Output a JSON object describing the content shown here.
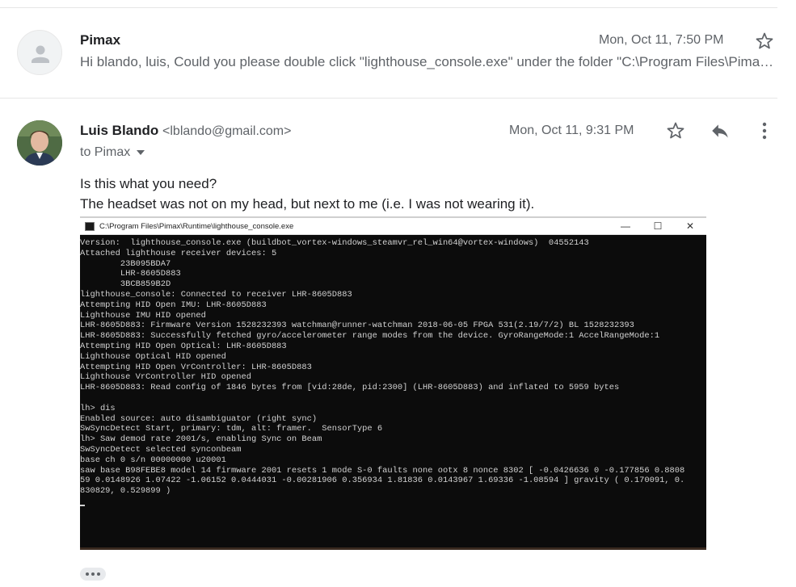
{
  "message1": {
    "sender": "Pimax",
    "date": "Mon, Oct 11, 7:50 PM",
    "snippet": "Hi blando, luis, Could you please double click \"lighthouse_console.exe\" under the folder \"C:\\Program Files\\Pimax\\Runtime\" and ..."
  },
  "message2": {
    "sender": "Luis Blando",
    "email": "<lblando@gmail.com>",
    "date": "Mon, Oct 11, 9:31 PM",
    "to": "to Pimax",
    "body": [
      "Is this what you need?",
      "The headset was not on my head, but next to me (i.e. I was not wearing it)."
    ]
  },
  "console": {
    "title": "C:\\Program Files\\Pimax\\Runtime\\lighthouse_console.exe",
    "controls": {
      "minimize": "—",
      "maximize": "☐",
      "close": "✕"
    },
    "lines": [
      "Version:  lighthouse_console.exe (buildbot_vortex-windows_steamvr_rel_win64@vortex-windows)  04552143",
      "Attached lighthouse receiver devices: 5",
      "        23B095BDA7",
      "        LHR-8605D883",
      "        3BCB859B2D",
      "lighthouse_console: Connected to receiver LHR-8605D883",
      "Attempting HID Open IMU: LHR-8605D883",
      "Lighthouse IMU HID opened",
      "LHR-8605D883: Firmware Version 1528232393 watchman@runner-watchman 2018-06-05 FPGA 531(2.19/7/2) BL 1528232393",
      "LHR-8605D883: Successfully fetched gyro/accelerometer range modes from the device. GyroRangeMode:1 AccelRangeMode:1",
      "Attempting HID Open Optical: LHR-8605D883",
      "Lighthouse Optical HID opened",
      "Attempting HID Open VrController: LHR-8605D883",
      "Lighthouse VrController HID opened",
      "LHR-8605D883: Read config of 1846 bytes from [vid:28de, pid:2300] (LHR-8605D883) and inflated to 5959 bytes",
      "",
      "lh> dis",
      "Enabled source: auto disambiguator (right sync)",
      "SwSyncDetect Start, primary: tdm, alt: framer.  SensorType 6",
      "lh> Saw demod rate 2001/s, enabling Sync on Beam",
      "SwSyncDetect selected synconbeam",
      "base ch 0 s/n 00000000 u20001",
      "saw base B98FEBE8 model 14 firmware 2001 resets 1 mode S-0 faults none ootx 8 nonce 8302 [ -0.0426636 0 -0.177856 0.8808",
      "59 0.0148926 1.07422 -1.06152 0.0444031 -0.00281906 0.356934 1.81836 0.0143967 1.69336 -1.08594 ] gravity ( 0.170091, 0.",
      "830829, 0.529899 )"
    ]
  },
  "icons": {
    "star": "star-icon",
    "reply": "reply-icon",
    "more": "more-vert-icon",
    "dropdown": "chevron-down-icon",
    "ellipsis": "ellipsis-icon"
  },
  "colors": {
    "text_primary": "#202124",
    "text_secondary": "#5f6368",
    "console_bg": "#0c0c0c",
    "console_text": "#d2d2d2"
  }
}
